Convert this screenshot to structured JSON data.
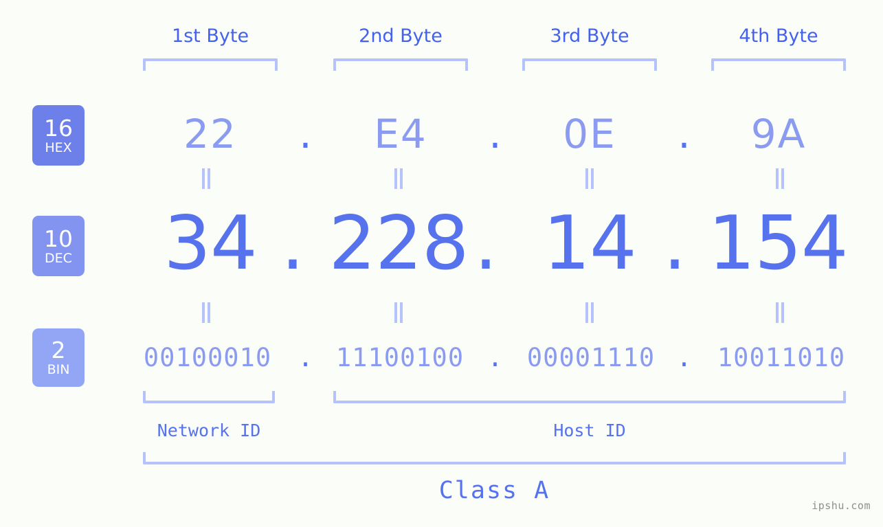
{
  "meta": {
    "watermark": "ipshu.com",
    "background_color": "#fbfdf9",
    "accent_color": "#5672ec",
    "light_accent_color": "#8b9bf0",
    "bracket_color": "#b6c2fb"
  },
  "byte_headers": [
    {
      "label": "1st Byte"
    },
    {
      "label": "2nd Byte"
    },
    {
      "label": "3rd Byte"
    },
    {
      "label": "4th Byte"
    }
  ],
  "bases": [
    {
      "number": "16",
      "abbr": "HEX",
      "badge_color": "#6d80ea"
    },
    {
      "number": "10",
      "abbr": "DEC",
      "badge_color": "#8294f0"
    },
    {
      "number": "2",
      "abbr": "BIN",
      "badge_color": "#93a6f5"
    }
  ],
  "separator": ".",
  "rows": {
    "hex": {
      "octets": [
        "22",
        "E4",
        "0E",
        "9A"
      ]
    },
    "dec": {
      "octets": [
        "34",
        "228",
        "14",
        "154"
      ]
    },
    "bin": {
      "octets": [
        "00100010",
        "11100100",
        "00001110",
        "10011010"
      ]
    }
  },
  "sections": {
    "network_id": {
      "label": "Network ID"
    },
    "host_id": {
      "label": "Host ID"
    },
    "class": {
      "label": "Class A"
    }
  },
  "equals_marks": {
    "glyph": "="
  }
}
